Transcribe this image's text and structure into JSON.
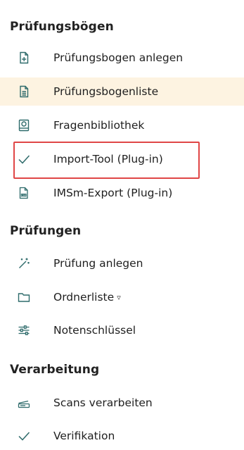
{
  "sections": [
    {
      "title": "Prüfungsbögen",
      "items": [
        {
          "label": "Prüfungsbogen anlegen",
          "icon": "file-plus-icon"
        },
        {
          "label": "Prüfungsbogenliste",
          "icon": "document-list-icon",
          "active": true
        },
        {
          "label": "Fragenbibliothek",
          "icon": "book-icon"
        },
        {
          "label": "Import-Tool (Plug-in)",
          "icon": "checkmark-icon",
          "highlighted": true
        },
        {
          "label": "IMSm-Export (Plug-in)",
          "icon": "csv-file-icon"
        }
      ]
    },
    {
      "title": "Prüfungen",
      "items": [
        {
          "label": "Prüfung anlegen",
          "icon": "magic-wand-icon"
        },
        {
          "label": "Ordnerliste",
          "icon": "folder-icon",
          "dropdown": true
        },
        {
          "label": "Notenschlüssel",
          "icon": "sliders-icon"
        }
      ]
    },
    {
      "title": "Verarbeitung",
      "items": [
        {
          "label": "Scans verarbeiten",
          "icon": "scanner-icon"
        },
        {
          "label": "Verifikation",
          "icon": "checkmark-icon"
        }
      ]
    }
  ],
  "colors": {
    "active_background": "#fdf3e1",
    "highlight_border": "#e04646",
    "icon_teal": "#2e6b6b"
  }
}
